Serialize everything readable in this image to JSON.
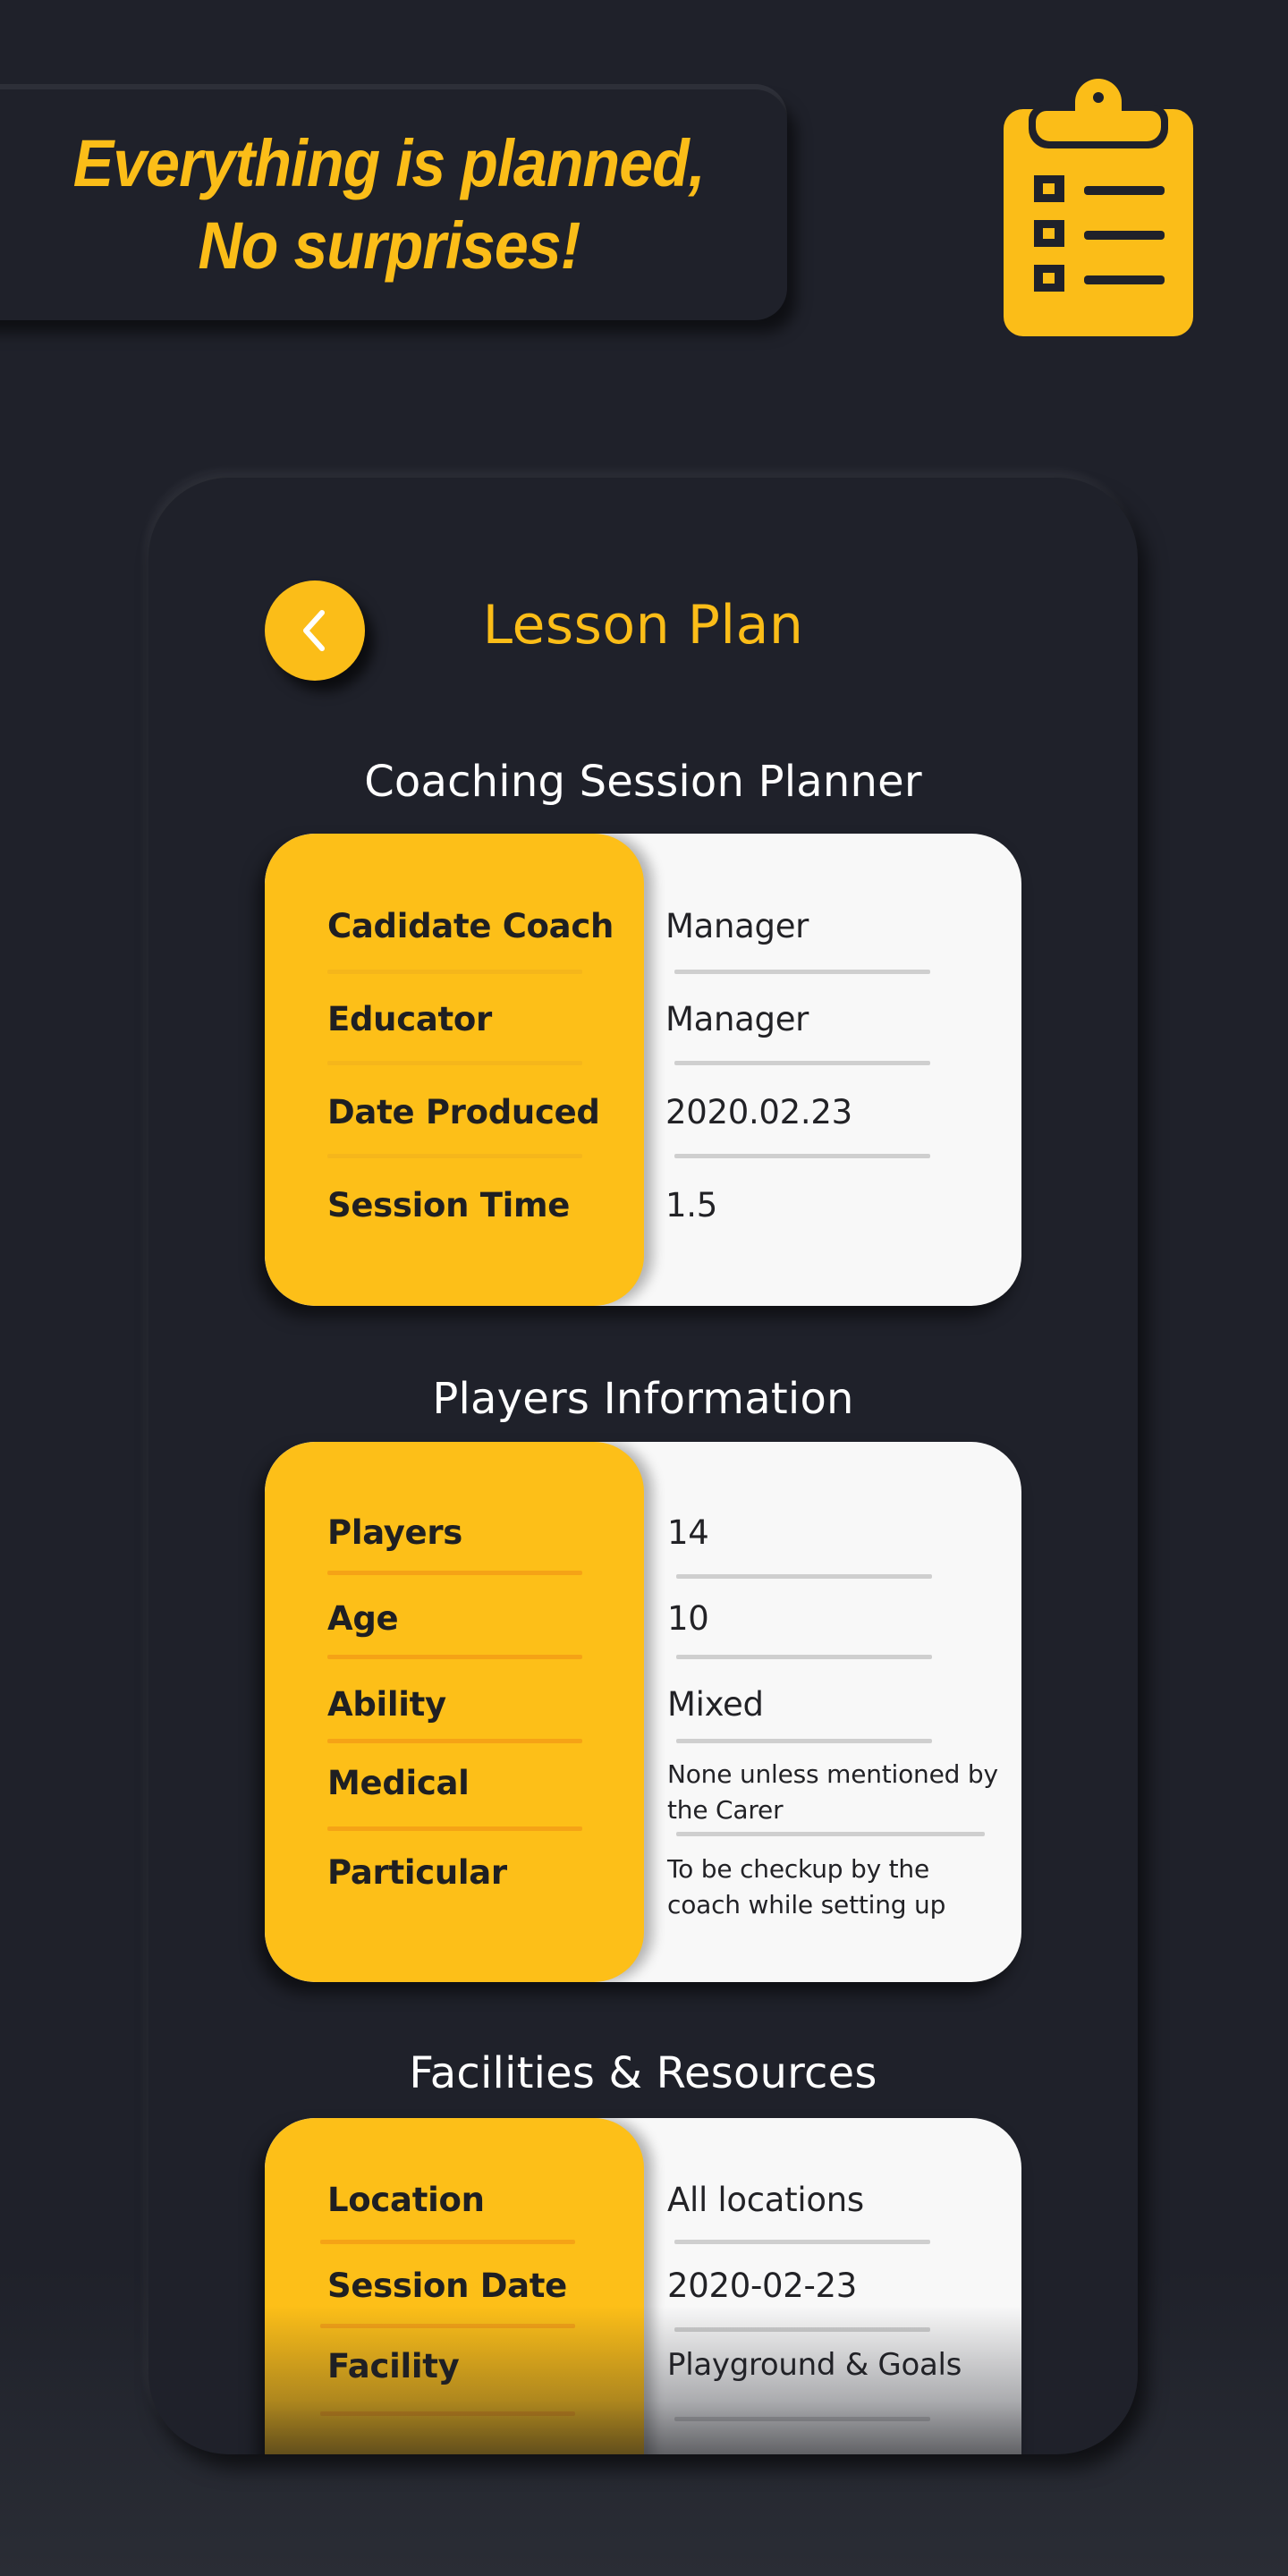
{
  "banner": {
    "line1": "Everything is planned,",
    "line2": "No surprises!",
    "icon": "clipboard-checklist-icon"
  },
  "colors": {
    "accent": "#fbbd18",
    "background": "#1f212a",
    "card_value_bg": "#f8f8f8",
    "divider_accent": "#f5a316",
    "divider_neutral": "#cfcfcf"
  },
  "screen": {
    "title": "Lesson Plan",
    "back_icon": "chevron-left-icon",
    "sections": [
      {
        "heading": "Coaching Session Planner",
        "rows": [
          {
            "label": "Cadidate Coach",
            "value": "Manager"
          },
          {
            "label": "Educator",
            "value": "Manager"
          },
          {
            "label": "Date Produced",
            "value": "2020.02.23"
          },
          {
            "label": "Session Time",
            "value": "1.5"
          }
        ]
      },
      {
        "heading": "Players Information",
        "rows": [
          {
            "label": "Players",
            "value": "14"
          },
          {
            "label": "Age",
            "value": "10"
          },
          {
            "label": "Ability",
            "value": "Mixed"
          },
          {
            "label": "Medical",
            "value": "None unless mentioned by the Carer"
          },
          {
            "label": "Particular",
            "value": "To be checkup by the coach while setting up"
          }
        ]
      },
      {
        "heading": "Facilities & Resources",
        "rows": [
          {
            "label": "Location",
            "value": "All locations"
          },
          {
            "label": "Session Date",
            "value": "2020-02-23"
          },
          {
            "label": "Facility",
            "value": "Playground & Goals"
          }
        ]
      }
    ]
  }
}
